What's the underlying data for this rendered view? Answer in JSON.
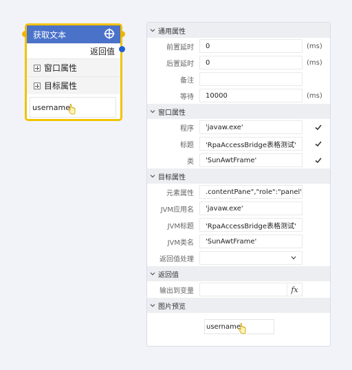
{
  "node": {
    "title": "获取文本",
    "return_label": "返回值",
    "sections": [
      {
        "label": "窗口属性"
      },
      {
        "label": "目标属性"
      }
    ],
    "preview_text": "username"
  },
  "panel": {
    "general": {
      "title": "通用属性",
      "pre_delay_label": "前置延时",
      "pre_delay_value": "0",
      "pre_delay_unit": "(ms)",
      "post_delay_label": "后置延时",
      "post_delay_value": "0",
      "post_delay_unit": "(ms)",
      "note_label": "备注",
      "note_value": "",
      "wait_label": "等待",
      "wait_value": "10000",
      "wait_unit": "(ms)"
    },
    "window": {
      "title": "窗口属性",
      "program_label": "程序",
      "program_value": "'javaw.exe'",
      "title_label": "标题",
      "title_value": "'RpaAccessBridge表格测试'",
      "class_label": "类",
      "class_value": "'SunAwtFrame'"
    },
    "target": {
      "title": "目标属性",
      "element_label": "元素属性",
      "element_value": ".contentPane\",\"role\":\"panel\"}]",
      "jvm_app_label": "JVM应用名",
      "jvm_app_value": "'javaw.exe'",
      "jvm_title_label": "JVM标题",
      "jvm_title_value": "'RpaAccessBridge表格测试'",
      "jvm_class_label": "JVM类名",
      "jvm_class_value": "'SunAwtFrame'",
      "return_handle_label": "返回值处理",
      "return_handle_value": ""
    },
    "return": {
      "title": "返回值",
      "output_label": "输出到变量",
      "output_value": "",
      "fx_label": "fx"
    },
    "preview": {
      "title": "图片预览",
      "text": "username"
    }
  },
  "colors": {
    "node_border": "#f2c200",
    "node_header": "#4a72c9",
    "out_port": "#1f5fd0",
    "section_bg": "#eceef2"
  }
}
